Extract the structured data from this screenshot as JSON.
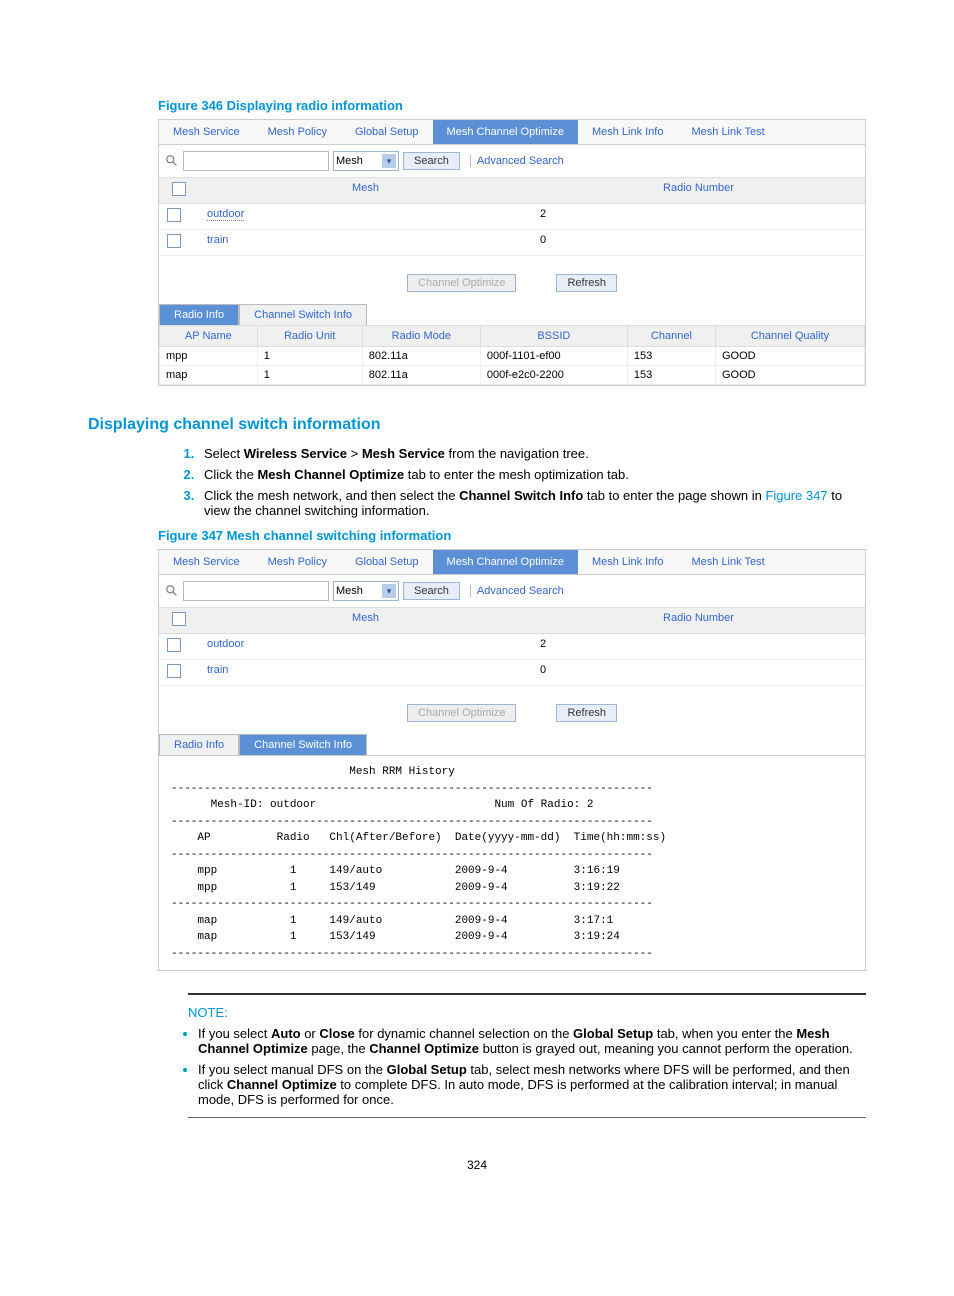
{
  "figure1": {
    "caption": "Figure 346 Displaying radio information"
  },
  "figure2": {
    "caption": "Figure 347 Mesh channel switching information"
  },
  "h2": "Displaying channel switch information",
  "tabs": {
    "t1": "Mesh Service",
    "t2": "Mesh Policy",
    "t3": "Global Setup",
    "t4": "Mesh Channel Optimize",
    "t5": "Mesh Link Info",
    "t6": "Mesh Link Test"
  },
  "search": {
    "sel": "Mesh",
    "btn": "Search",
    "adv": "Advanced Search"
  },
  "mhead": {
    "mesh": "Mesh",
    "num": "Radio Number"
  },
  "rows1": {
    "r1_name": "outdoor",
    "r1_num": "2",
    "r2_name": "train",
    "r2_num": "0"
  },
  "rows2": {
    "r1_name": "outdoor",
    "r1_num": "2",
    "r2_name": "train",
    "r2_num": "0"
  },
  "btns": {
    "opt": "Channel Optimize",
    "refresh": "Refresh"
  },
  "subtabs": {
    "a": "Radio Info",
    "b": "Channel Switch Info"
  },
  "rtable": {
    "h1": "AP Name",
    "h2": "Radio Unit",
    "h3": "Radio Mode",
    "h4": "BSSID",
    "h5": "Channel",
    "h6": "Channel Quality",
    "r1": {
      "c1": "mpp",
      "c2": "1",
      "c3": "802.11a",
      "c4": "000f-1101-ef00",
      "c5": "153",
      "c6": "GOOD"
    },
    "r2": {
      "c1": "map",
      "c2": "1",
      "c3": "802.11a",
      "c4": "000f-e2c0-2200",
      "c5": "153",
      "c6": "GOOD"
    }
  },
  "steps": {
    "s1a": "Select ",
    "s1b": "Wireless Service",
    "s1c": " > ",
    "s1d": "Mesh Service",
    "s1e": " from the navigation tree.",
    "s2a": "Click the ",
    "s2b": "Mesh Channel Optimize",
    "s2c": " tab to enter the mesh optimization tab.",
    "s3a": "Click the mesh network, and then select the ",
    "s3b": "Channel Switch Info",
    "s3c": " tab to enter the page shown in ",
    "s3d": "Figure 347",
    "s3e": " to view the channel switching information."
  },
  "history": "                           Mesh RRM History\n-------------------------------------------------------------------------\n      Mesh-ID: outdoor                           Num Of Radio: 2\n-------------------------------------------------------------------------\n    AP          Radio   Chl(After/Before)  Date(yyyy-mm-dd)  Time(hh:mm:ss)\n-------------------------------------------------------------------------\n    mpp           1     149/auto           2009-9-4          3:16:19\n    mpp           1     153/149            2009-9-4          3:19:22\n-------------------------------------------------------------------------\n    map           1     149/auto           2009-9-4          3:17:1\n    map           1     153/149            2009-9-4          3:19:24\n-------------------------------------------------------------------------",
  "note": {
    "label": "NOTE:",
    "b1a": "If you select ",
    "b1b": "Auto",
    "b1c": " or ",
    "b1d": "Close",
    "b1e": " for dynamic channel selection on the ",
    "b1f": "Global Setup",
    "b1g": " tab, when you enter the ",
    "b1h": "Mesh Channel Optimize",
    "b1i": " page, the ",
    "b1j": "Channel Optimize",
    "b1k": " button is grayed out, meaning you cannot perform the operation.",
    "b2a": "If you select manual DFS on the ",
    "b2b": "Global Setup",
    "b2c": " tab, select mesh networks where DFS will be performed, and then click ",
    "b2d": "Channel Optimize",
    "b2e": " to complete DFS. In auto mode, DFS is performed at the calibration interval; in manual mode, DFS is performed for once."
  },
  "pagenum": "324"
}
